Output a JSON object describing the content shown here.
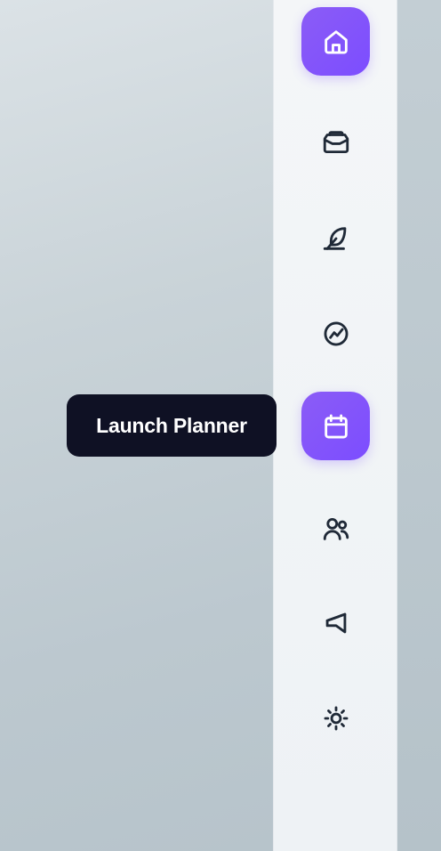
{
  "nav": {
    "items": [
      {
        "name": "home",
        "icon": "home-icon",
        "active": true
      },
      {
        "name": "inbox",
        "icon": "inbox-icon",
        "active": false
      },
      {
        "name": "write",
        "icon": "feather-icon",
        "active": false
      },
      {
        "name": "analytics",
        "icon": "trend-chart-icon",
        "active": false
      },
      {
        "name": "launch-planner",
        "icon": "calendar-icon",
        "active": true
      },
      {
        "name": "team",
        "icon": "users-icon",
        "active": false
      },
      {
        "name": "announcements",
        "icon": "megaphone-icon",
        "active": false
      },
      {
        "name": "settings",
        "icon": "sun-icon",
        "active": false
      }
    ],
    "accent_color": "#7c4dff",
    "tooltip_bg": "#0f1124"
  },
  "tooltip": {
    "label": "Launch Planner"
  }
}
